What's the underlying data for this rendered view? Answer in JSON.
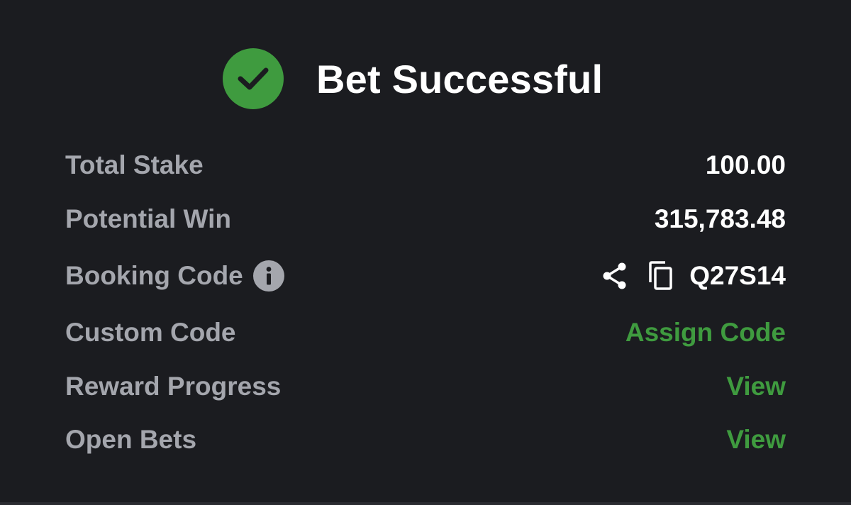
{
  "header": {
    "title": "Bet Successful"
  },
  "summary": {
    "rows": [
      {
        "label": "Total Stake",
        "value": "100.00"
      },
      {
        "label": "Potential Win",
        "value": "315,783.48"
      },
      {
        "label": "Booking Code",
        "value": "Q27S14"
      },
      {
        "label": "Custom Code",
        "value": "Assign Code"
      },
      {
        "label": "Reward Progress",
        "value": "View"
      },
      {
        "label": "Open Bets",
        "value": "View"
      }
    ]
  },
  "colors": {
    "background": "#1b1c20",
    "accent_green": "#3f9b3f",
    "label_gray": "#a4a6ad",
    "value_white": "#ffffff"
  },
  "icons": {
    "status": "check-circle-icon",
    "booking_info": "info-icon",
    "share": "share-icon",
    "copy": "copy-icon"
  }
}
